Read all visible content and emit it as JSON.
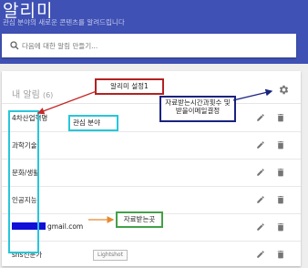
{
  "header": {
    "title": "알리미",
    "subtitle": "관심 분야의 새로운 콘텐츠를 알려드립니다"
  },
  "search": {
    "placeholder": "다음에 대한 알림 만들기..."
  },
  "card": {
    "title": "내 알림",
    "count": "(6)"
  },
  "alerts": [
    {
      "label": "4차산업혁명"
    },
    {
      "label": "과학기술"
    },
    {
      "label": "문화/생활"
    },
    {
      "label": "인공지능"
    },
    {
      "label": "gmail.com"
    },
    {
      "label": "sns전문가"
    }
  ],
  "annotations": {
    "settings": "알리미 설정1",
    "schedule": "자료받는시간과횟수 및 받을이메일결정",
    "interest": "관심 분야",
    "receiver": "자료받는곳"
  },
  "watermark": "Lightshot",
  "colors": {
    "header": "#3f51b5",
    "annotation_red": "#b22222",
    "annotation_navy": "#1a237e",
    "annotation_cyan": "#26c6da",
    "annotation_green": "#43a047",
    "redaction": "#1010d8"
  },
  "icons": {
    "settings": "gear-icon",
    "edit": "pencil-icon",
    "delete": "trash-icon",
    "search": "search-icon"
  }
}
